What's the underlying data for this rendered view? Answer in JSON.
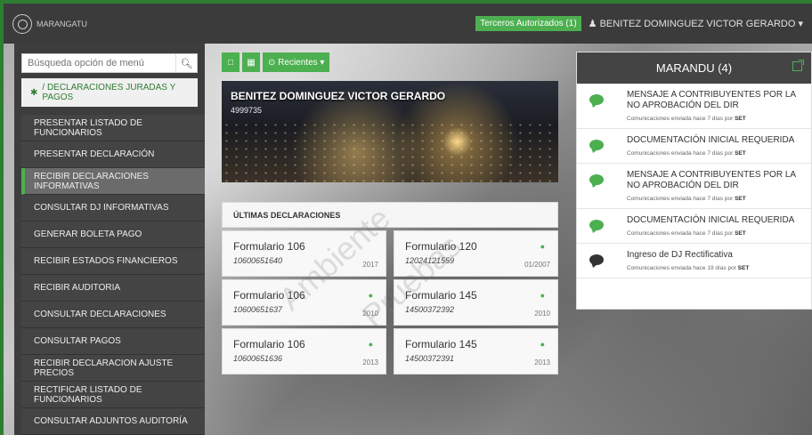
{
  "header": {
    "logo_text": "MARANGATU",
    "terceros_label": "Terceros Autorizados (1)",
    "user_name": "BENITEZ DOMINGUEZ VICTOR GERARDO",
    "user_icon": "user-icon",
    "dropdown_icon": "chevron-down-icon"
  },
  "sidebar": {
    "search_placeholder": "Búsqueda opción de menú",
    "breadcrumb_home": "✱",
    "breadcrumb_text": "/ DECLARACIONES JURADAS Y PAGOS",
    "items": [
      {
        "label": "PRESENTAR LISTADO DE FUNCIONARIOS"
      },
      {
        "label": "PRESENTAR DECLARACIÓN"
      },
      {
        "label": "RECIBIR DECLARACIONES INFORMATIVAS"
      },
      {
        "label": "CONSULTAR DJ INFORMATIVAS"
      },
      {
        "label": "GENERAR BOLETA PAGO"
      },
      {
        "label": "RECIBIR ESTADOS FINANCIEROS"
      },
      {
        "label": "RECIBIR AUDITORIA"
      },
      {
        "label": "CONSULTAR DECLARACIONES"
      },
      {
        "label": "CONSULTAR PAGOS"
      },
      {
        "label": "RECIBIR DECLARACION AJUSTE PRECIOS"
      },
      {
        "label": "RECTIFICAR LISTADO DE FUNCIONARIOS"
      },
      {
        "label": "CONSULTAR ADJUNTOS AUDITORÍA"
      }
    ],
    "active_index": 2
  },
  "toolbar": {
    "recientes_label": "⊙ Recientes ▾"
  },
  "hero": {
    "name": "BENITEZ DOMINGUEZ VICTOR GERARDO",
    "ruc": "4999735"
  },
  "ultimas": {
    "title": "ÚLTIMAS DECLARACIONES",
    "cards": [
      {
        "form": "Formulario 106",
        "number": "10600651640",
        "period": "2017",
        "eye": false
      },
      {
        "form": "Formulario 120",
        "number": "12024121559",
        "period": "01/2007",
        "eye": true
      },
      {
        "form": "Formulario 106",
        "number": "10600651637",
        "period": "2010",
        "eye": true
      },
      {
        "form": "Formulario 145",
        "number": "14500372392",
        "period": "2010",
        "eye": true
      },
      {
        "form": "Formulario 106",
        "number": "10600651636",
        "period": "2013",
        "eye": true
      },
      {
        "form": "Formulario 145",
        "number": "14500372391",
        "period": "2013",
        "eye": true
      }
    ]
  },
  "watermark": {
    "line1": "Ambiente",
    "line2": "Pruebas"
  },
  "marandu": {
    "title": "MARANDU (4)",
    "messages": [
      {
        "title": "MENSAJE A CONTRIBUYENTES POR LA NO APROBACIÓN DEL DIR",
        "meta": "Comunicaciones enviada hace 7 días por",
        "by": "SET",
        "read": false
      },
      {
        "title": "DOCUMENTACIÓN INICIAL REQUERIDA",
        "meta": "Comunicaciones enviada hace 7 días por",
        "by": "SET",
        "read": false
      },
      {
        "title": "MENSAJE A CONTRIBUYENTES POR LA NO APROBACIÓN DEL DIR",
        "meta": "Comunicaciones enviada hace 7 días por",
        "by": "SET",
        "read": false
      },
      {
        "title": "DOCUMENTACIÓN INICIAL REQUERIDA",
        "meta": "Comunicaciones enviada hace 7 días por",
        "by": "SET",
        "read": false
      },
      {
        "title": "Ingreso de DJ Rectificativa",
        "meta": "Comunicaciones enviada hace 19 días por",
        "by": "SET",
        "read": true
      }
    ]
  },
  "colors": {
    "accent": "#4caf50",
    "dark": "#3d3d3d"
  }
}
